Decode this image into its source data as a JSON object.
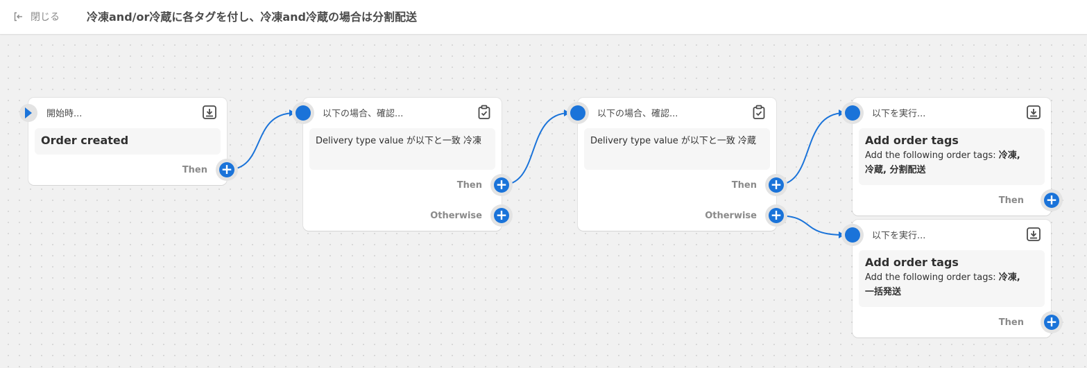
{
  "header": {
    "close_label": "閉じる",
    "title": "冷凍and/or冷蔵に各タグを付し、冷凍and冷蔵の場合は分割配送"
  },
  "trigger": {
    "title": "開始時...",
    "event": "Order created",
    "then_label": "Then",
    "icon": "download-icon"
  },
  "condition1": {
    "title": "以下の場合、確認...",
    "text": "Delivery type value が以下と一致 冷凍",
    "then_label": "Then",
    "otherwise_label": "Otherwise",
    "icon": "clipboard-check-icon"
  },
  "condition2": {
    "title": "以下の場合、確認...",
    "text": "Delivery type value が以下と一致 冷蔵",
    "then_label": "Then",
    "otherwise_label": "Otherwise",
    "icon": "clipboard-check-icon"
  },
  "action1": {
    "title": "以下を実行...",
    "heading": "Add order tags",
    "desc_prefix": "Add the following order tags: ",
    "tags": "冷凍,",
    "tags_line2": "冷蔵, 分割配送",
    "then_label": "Then",
    "icon": "download-icon"
  },
  "action2": {
    "title": "以下を実行...",
    "heading": "Add order tags",
    "desc_prefix": "Add the following order tags: ",
    "tags": "冷凍,",
    "tags_line2": "一括発送",
    "then_label": "Then",
    "icon": "download-icon"
  },
  "colors": {
    "accent": "#1a73d9",
    "canvas": "#f1f1f1",
    "card": "#ffffff"
  }
}
